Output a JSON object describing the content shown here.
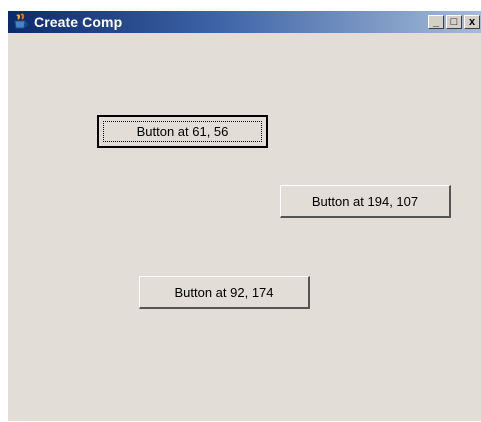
{
  "window": {
    "title": "Create Comp",
    "controls": {
      "minimize": "_",
      "maximize": "□",
      "close": "x"
    }
  },
  "buttons": [
    {
      "label": "Button at 61, 56"
    },
    {
      "label": "Button at 194, 107"
    },
    {
      "label": "Button at 92, 174"
    }
  ],
  "colors": {
    "window_bg": "#e3ddd8",
    "titlebar_start": "#0b2a6b",
    "titlebar_end": "#a6bcd8"
  },
  "icons": {
    "app": "java-cup-icon",
    "minimize": "minimize-icon",
    "maximize": "maximize-icon",
    "close": "close-icon"
  }
}
